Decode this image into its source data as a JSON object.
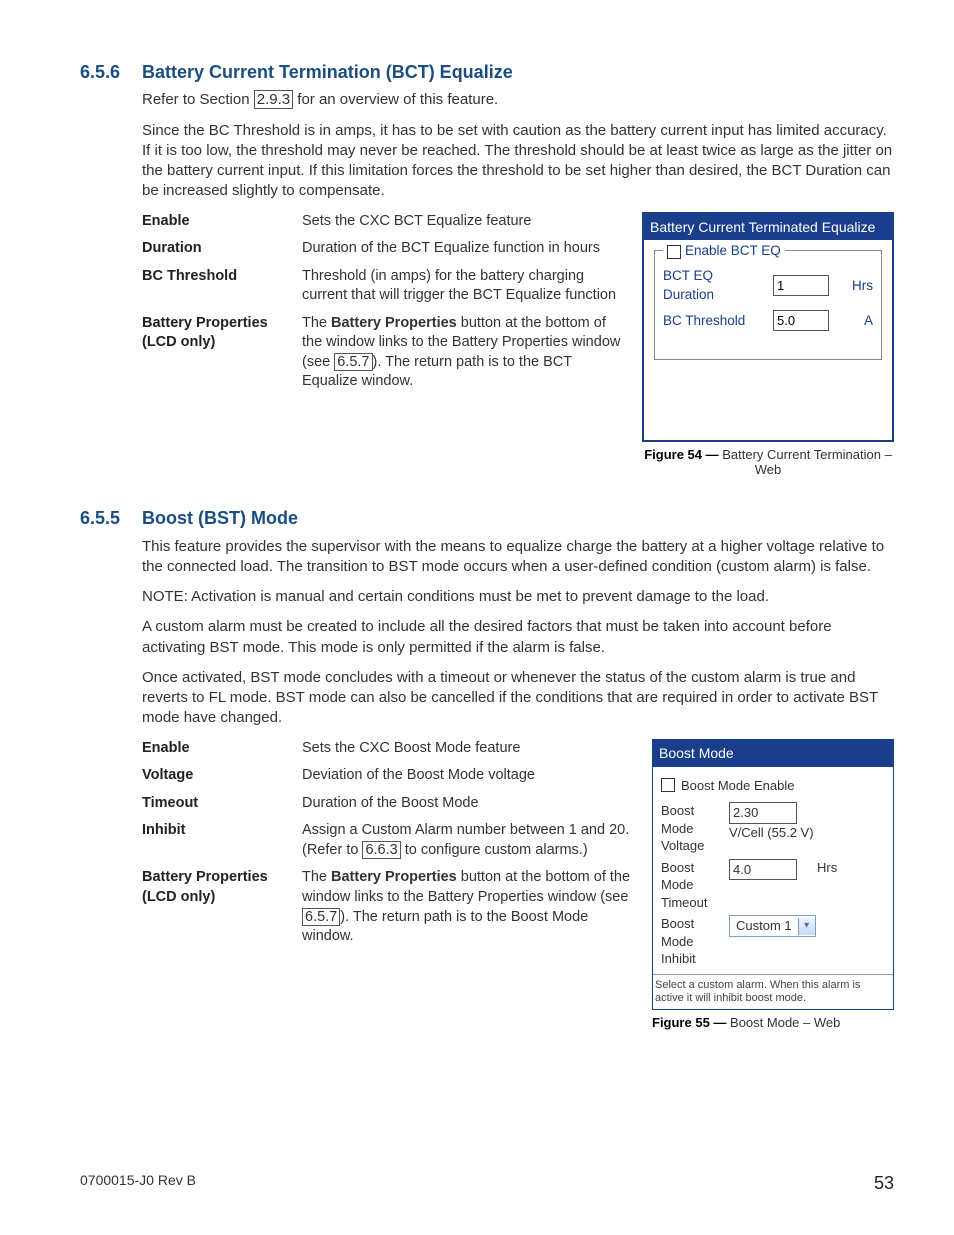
{
  "sections": {
    "s656": {
      "num": "6.5.6",
      "title": "Battery Current Termination (BCT) Equalize",
      "p1_a": "Refer to Section ",
      "ref1": "2.9.3",
      "p1_b": " for an overview of this feature.",
      "p2": "Since the BC Threshold is in amps, it has to be set with caution as the battery current input has limited accuracy. If it is too low, the threshold may never be reached. The threshold should be at least twice as large as the jitter on the battery current input. If this limitation forces the threshold to be set higher than desired, the BCT Duration can be increased slightly to compensate.",
      "defs": [
        {
          "t": "Enable",
          "d_plain": "Sets the CXC BCT Equalize feature"
        },
        {
          "t": "Duration",
          "d_plain": "Duration of the BCT Equalize function in hours"
        },
        {
          "t": "BC Threshold",
          "d_plain": "Threshold (in amps) for the battery charging current that will trigger the BCT Equalize function"
        },
        {
          "t": "Battery Properties (LCD only)",
          "d_pre": "The ",
          "d_bold": "Battery Properties",
          "d_mid": " button at the bottom of the window links to the Battery Properties window (see ",
          "d_ref": "6.5.7",
          "d_post": "). The return path is to the BCT Equalize window."
        }
      ],
      "fig54": {
        "panel_title": "Battery Current Terminated Equalize",
        "legend": "Enable BCT EQ",
        "rows": [
          {
            "lbl": "BCT EQ Duration",
            "val": "1",
            "unit": "Hrs"
          },
          {
            "lbl": "BC Threshold",
            "val": "5.0",
            "unit": "A"
          }
        ],
        "cap_b": "Figure 54  —  ",
        "cap": "Battery Current Termination – Web"
      }
    },
    "s655": {
      "num": "6.5.5",
      "title": "Boost (BST) Mode",
      "p1": "This feature provides the supervisor with the means to equalize charge the battery at a higher voltage relative to the connected load. The transition to BST mode occurs when a user-defined condition (custom alarm) is false.",
      "p2": "NOTE:  Activation is manual and certain conditions must be met to prevent damage to the load.",
      "p3": "A custom alarm must be created to include all the desired factors that must be taken into account before activating BST mode. This mode is only permitted if the alarm is false.",
      "p4": "Once activated, BST mode concludes with a timeout or whenever the status of the custom alarm is true and reverts to FL mode. BST mode can also be cancelled if the conditions that are required in order to activate BST mode have changed.",
      "defs": [
        {
          "t": "Enable",
          "d_plain": "Sets the CXC Boost Mode feature"
        },
        {
          "t": "Voltage",
          "d_plain": "Deviation of the Boost Mode voltage"
        },
        {
          "t": "Timeout",
          "d_plain": "Duration of the Boost Mode"
        },
        {
          "t": "Inhibit",
          "d_pre": "Assign a Custom Alarm number between 1 and 20. (Refer to ",
          "d_ref": "6.6.3",
          "d_post": " to configure custom alarms.)"
        },
        {
          "t": "Battery Properties (LCD only)",
          "d_pre": "The ",
          "d_bold": "Battery Properties",
          "d_mid": " button at the bottom of the window links to the Battery Properties window (see ",
          "d_ref": "6.5.7",
          "d_post": "). The return path is to the Boost Mode window."
        }
      ],
      "fig55": {
        "panel_title": "Boost Mode",
        "enable_lbl": "Boost Mode Enable",
        "rows": [
          {
            "lbl": "Boost Mode Voltage",
            "val": "2.30",
            "unit": "V/Cell (55.2 V)"
          },
          {
            "lbl": "Boost Mode Timeout",
            "val": "4.0",
            "unit": "Hrs"
          }
        ],
        "inhibit_lbl": "Boost Mode Inhibit",
        "inhibit_sel": "Custom 1",
        "hint": "Select a custom alarm. When this alarm is active it will inhibit boost mode.",
        "cap_b": "Figure 55  —  ",
        "cap": "Boost Mode – Web"
      }
    }
  },
  "footer": {
    "left": "0700015-J0    Rev B",
    "page": "53"
  }
}
